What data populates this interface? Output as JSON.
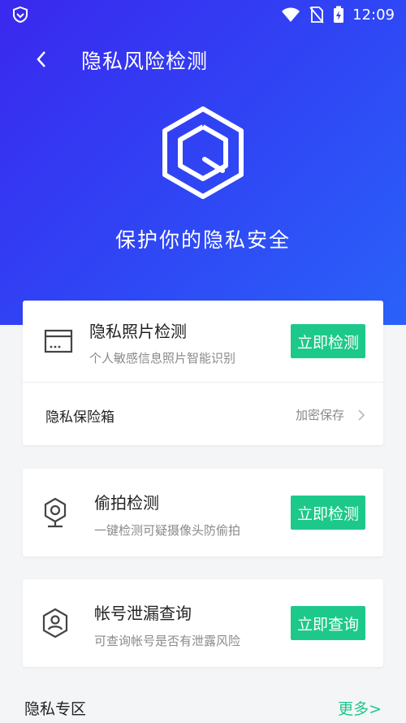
{
  "status_bar": {
    "time": "12:09"
  },
  "header": {
    "title": "隐私风险检测"
  },
  "hero": {
    "subtitle": "保护你的隐私安全"
  },
  "photo_check": {
    "title": "隐私照片检测",
    "subtitle": "个人敏感信息照片智能识别",
    "button": "立即检测"
  },
  "vault": {
    "label": "隐私保险箱",
    "value": "加密保存"
  },
  "camera_check": {
    "title": "偷拍检测",
    "subtitle": "一键检测可疑摄像头防偷拍",
    "button": "立即检测"
  },
  "account_check": {
    "title": "帐号泄漏查询",
    "subtitle": "可查询帐号是否有泄露风险",
    "button": "立即查询"
  },
  "section": {
    "title": "隐私专区",
    "more": "更多>"
  },
  "colors": {
    "accent": "#1dc98a",
    "hero_start": "#3a28ee",
    "hero_end": "#2a62f9"
  }
}
